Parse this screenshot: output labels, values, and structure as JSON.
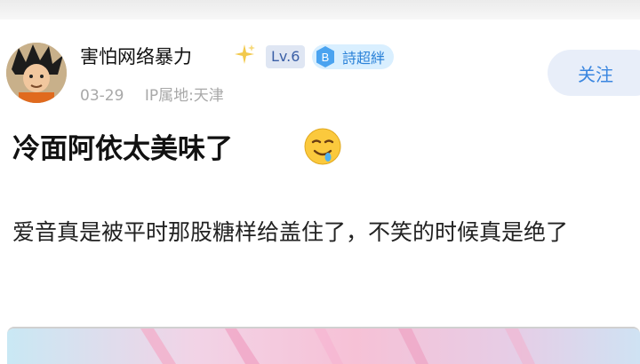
{
  "post": {
    "author": {
      "name": "害怕网络暴力",
      "level": "Lv.6",
      "fan_badge": {
        "icon": "B",
        "label": "詩超絆"
      }
    },
    "meta": {
      "date": "03-29",
      "ip": "IP属地:天津"
    },
    "follow_label": "关注",
    "title": "冷面阿依太美味了",
    "body": "爱音真是被平时那股糖样给盖住了，不笑的时候真是绝了"
  },
  "icons": {
    "sparkle": "sparkle-icon",
    "emoji": "drooling-face-emoji"
  },
  "colors": {
    "accent": "#3a86e0",
    "level_text": "#3a5fa6",
    "meta_text": "#a8a8a8"
  }
}
